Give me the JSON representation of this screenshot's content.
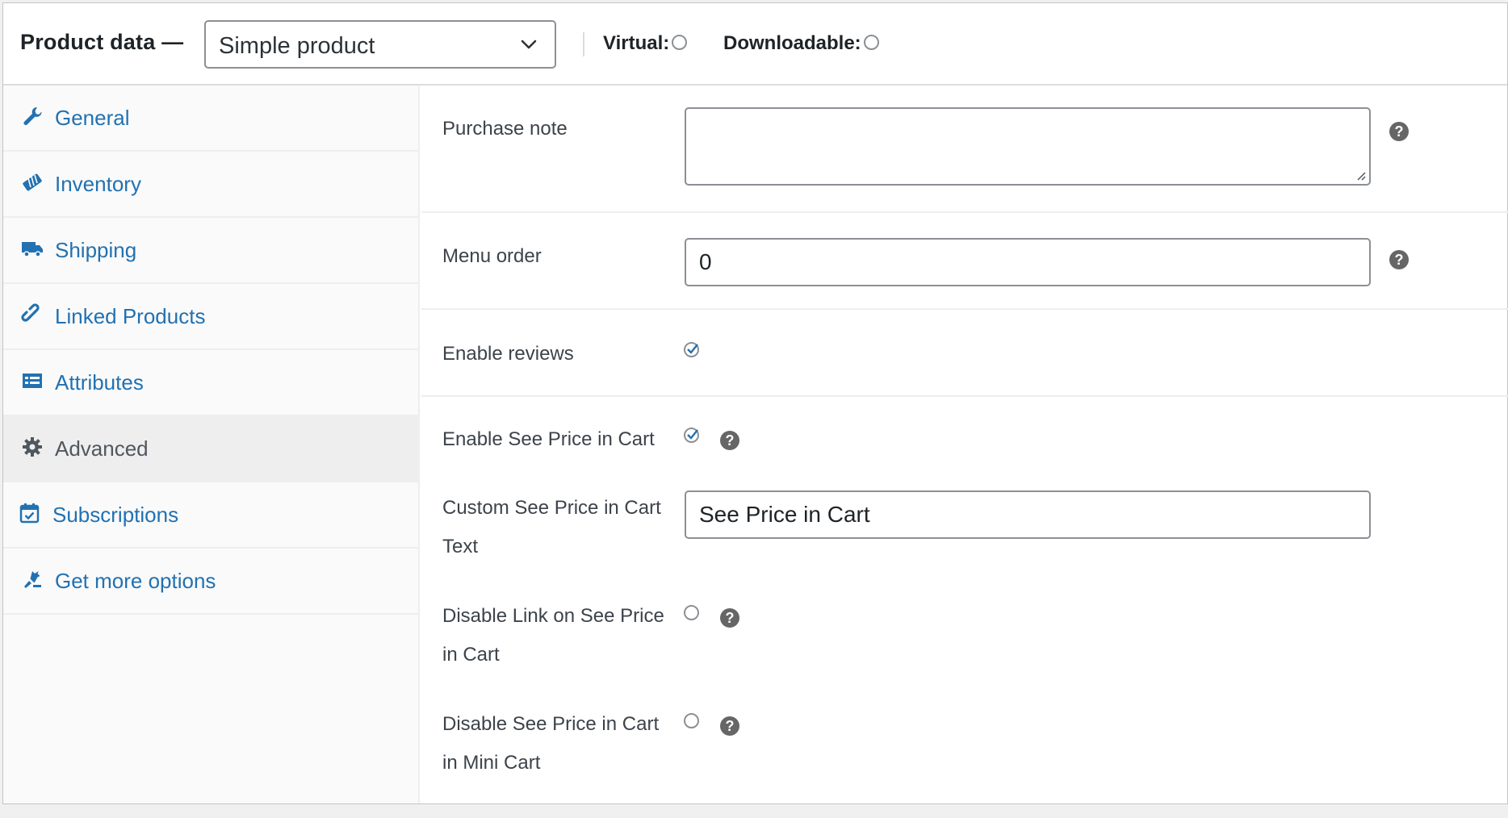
{
  "header": {
    "title": "Product data —",
    "product_type": "Simple product",
    "virtual_label": "Virtual:",
    "virtual_checked": false,
    "downloadable_label": "Downloadable:",
    "downloadable_checked": false
  },
  "sidebar": {
    "items": [
      {
        "label": "General",
        "icon": "wrench-icon"
      },
      {
        "label": "Inventory",
        "icon": "tag-icon"
      },
      {
        "label": "Shipping",
        "icon": "truck-icon"
      },
      {
        "label": "Linked Products",
        "icon": "link-icon"
      },
      {
        "label": "Attributes",
        "icon": "list-table-icon"
      },
      {
        "label": "Advanced",
        "icon": "gear-icon",
        "active": true
      },
      {
        "label": "Subscriptions",
        "icon": "calendar-check-icon"
      },
      {
        "label": "Get more options",
        "icon": "plugin-icon"
      }
    ]
  },
  "advanced": {
    "purchase_note": {
      "label": "Purchase note",
      "value": ""
    },
    "menu_order": {
      "label": "Menu order",
      "value": "0"
    },
    "enable_reviews": {
      "label": "Enable reviews",
      "checked": true
    },
    "enable_see_price": {
      "label": "Enable See Price in Cart",
      "checked": true
    },
    "custom_text": {
      "label_line1": "Custom See Price in Cart",
      "label_line2": "Text",
      "value": "See Price in Cart"
    },
    "disable_link": {
      "label_line1": "Disable Link on See Price",
      "label_line2": "in Cart",
      "checked": false
    },
    "disable_mini_cart": {
      "label_line1": "Disable See Price in Cart",
      "label_line2": "in Mini Cart",
      "checked": false
    },
    "help_glyph": "?"
  },
  "colors": {
    "link": "#2271b1",
    "active_tab_bg": "#eeeeee",
    "border": "#8c8f94",
    "help_bg": "#666666"
  }
}
